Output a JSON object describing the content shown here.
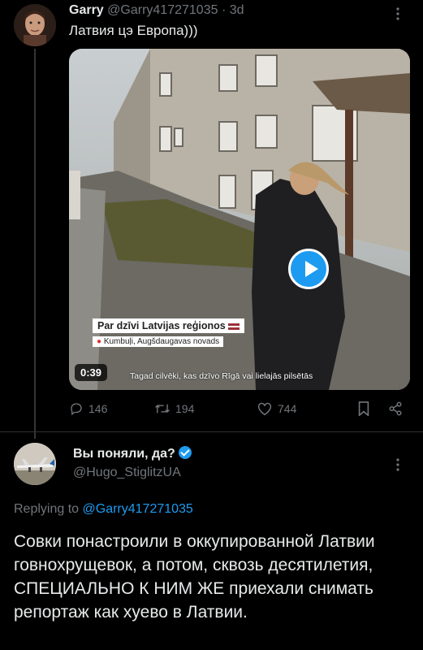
{
  "tweet1": {
    "name": "Garry",
    "handle": "@Garry417271035",
    "separator": "·",
    "age": "3d",
    "text": "Латвия цэ Европа)))",
    "media": {
      "caption_title": "Par dzīvi Latvijas reģionos",
      "location": "Kumbuļi, Augšdaugavas novads",
      "subtitle": "Tagad cilvēki, kas dzīvo Rīgā vai lielajās pilsētās",
      "duration": "0:39"
    },
    "actions": {
      "replies": "146",
      "retweets": "194",
      "likes": "744"
    }
  },
  "tweet2": {
    "name": "Вы поняли, да?",
    "handle": "@Hugo_StiglitzUA",
    "replying_prefix": "Replying to",
    "replying_handle": "@Garry417271035",
    "text": "Совки понастроили в оккупированной Латвии говнохрущевок, а потом, сквозь десятилетия, СПЕЦИАЛЬНО К НИМ ЖЕ приехали снимать репортаж как хуево в Латвии."
  },
  "icons": [
    "more-icon",
    "play-icon",
    "reply-icon",
    "retweet-icon",
    "like-icon",
    "bookmark-icon",
    "share-icon",
    "verified-icon"
  ],
  "colors": {
    "accent": "#1d9bf0",
    "muted": "#71767b",
    "text": "#e7e9ea",
    "background": "#000000"
  }
}
